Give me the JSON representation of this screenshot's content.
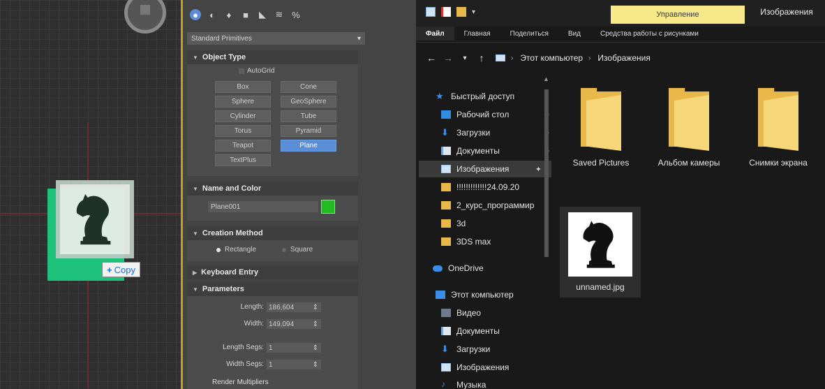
{
  "viewport": {
    "copy_tooltip": "Copy",
    "colors": {
      "drag_frame": "#1fc27a",
      "grid": "#3a3a3a"
    }
  },
  "panel": {
    "tab_icons": [
      "create-icon",
      "modify-icon",
      "hierarchy-icon",
      "motion-icon",
      "display-icon",
      "utilities-icon",
      "link-icon"
    ],
    "category_dropdown": "Standard Primitives",
    "object_type": {
      "title": "Object Type",
      "autogrid_label": "AutoGrid",
      "buttons": [
        "Box",
        "Cone",
        "Sphere",
        "GeoSphere",
        "Cylinder",
        "Tube",
        "Torus",
        "Pyramid",
        "Teapot",
        "Plane",
        "TextPlus"
      ],
      "active_button": "Plane"
    },
    "name_and_color": {
      "title": "Name and Color",
      "name_value": "Plane001",
      "color": "#22bb22"
    },
    "creation_method": {
      "title": "Creation Method",
      "option_rect": "Rectangle",
      "option_square": "Square"
    },
    "keyboard_entry": {
      "title": "Keyboard Entry"
    },
    "parameters": {
      "title": "Parameters",
      "length_label": "Length:",
      "length_value": "186,604",
      "width_label": "Width:",
      "width_value": "149,094",
      "length_segs_label": "Length Segs:",
      "length_segs_value": "1",
      "width_segs_label": "Width Segs:",
      "width_segs_value": "1",
      "render_multipliers_label": "Render Multipliers"
    }
  },
  "explorer": {
    "manage_tab": "Управление",
    "window_title": "Изображения",
    "ribbon_tabs": [
      "Файл",
      "Главная",
      "Поделиться",
      "Вид",
      "Средства работы с рисунками"
    ],
    "address": {
      "root": "Этот компьютер",
      "current": "Изображения"
    },
    "nav_items": [
      {
        "label": "Быстрый доступ",
        "icon": "star-icon",
        "pinned": false
      },
      {
        "label": "Рабочий стол",
        "icon": "desktop-icon",
        "pinned": true
      },
      {
        "label": "Загрузки",
        "icon": "download-icon",
        "pinned": true
      },
      {
        "label": "Документы",
        "icon": "documents-icon",
        "pinned": true
      },
      {
        "label": "Изображения",
        "icon": "pictures-icon",
        "pinned": true
      },
      {
        "label": "!!!!!!!!!!!!!24.09.20",
        "icon": "folder-icon",
        "pinned": false
      },
      {
        "label": "2_курс_программир",
        "icon": "folder-icon",
        "pinned": false
      },
      {
        "label": "3d",
        "icon": "folder-icon",
        "pinned": false
      },
      {
        "label": "3DS max",
        "icon": "folder-icon",
        "pinned": false
      },
      {
        "label": "OneDrive",
        "icon": "cloud-icon",
        "pinned": false
      },
      {
        "label": "Этот компьютер",
        "icon": "computer-icon",
        "pinned": false
      },
      {
        "label": "Видео",
        "icon": "video-icon",
        "pinned": false
      },
      {
        "label": "Документы",
        "icon": "documents-icon",
        "pinned": false
      },
      {
        "label": "Загрузки",
        "icon": "download-icon",
        "pinned": false
      },
      {
        "label": "Изображения",
        "icon": "pictures-icon",
        "pinned": false
      },
      {
        "label": "Музыка",
        "icon": "music-icon",
        "pinned": false
      }
    ],
    "selected_nav": "Изображения",
    "folders": [
      "Saved Pictures",
      "Альбом камеры",
      "Снимки экрана"
    ],
    "file": {
      "name": "unnamed.jpg"
    }
  }
}
